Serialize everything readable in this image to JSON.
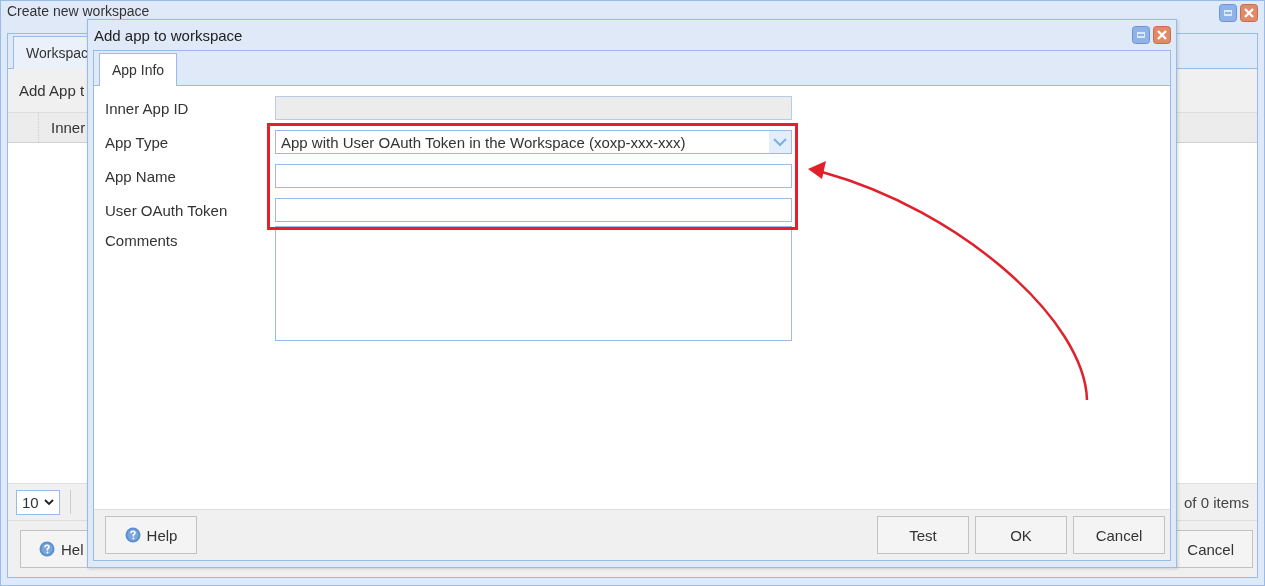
{
  "background_window": {
    "title": "Create new workspace",
    "tabs": [
      {
        "label": "Workspac",
        "selected": true
      }
    ],
    "toolbar_text": "Add App t",
    "grid": {
      "columns": [
        "Inner"
      ]
    },
    "paging": {
      "page_size": "10",
      "summary": "of 0 items"
    },
    "buttons": [
      {
        "label": "Hel",
        "kind": "help"
      },
      {
        "label": "Cancel",
        "kind": "plain"
      }
    ]
  },
  "dialog": {
    "title": "Add app to workspace",
    "tabs": [
      {
        "label": "App Info",
        "selected": true
      }
    ],
    "fields": [
      {
        "label": "Inner App ID",
        "kind": "text",
        "disabled": true
      },
      {
        "label": "App Type",
        "kind": "select",
        "value": "App with User OAuth Token in the Workspace (xoxp-xxx-xxx)"
      },
      {
        "label": "App Name",
        "kind": "text",
        "disabled": false
      },
      {
        "label": "User OAuth Token",
        "kind": "text",
        "disabled": false
      },
      {
        "label": "Comments",
        "kind": "textarea"
      }
    ],
    "buttons": [
      {
        "label": "Help",
        "kind": "help"
      },
      {
        "label": "Test",
        "kind": "plain"
      },
      {
        "label": "OK",
        "kind": "plain"
      },
      {
        "label": "Cancel",
        "kind": "plain"
      }
    ]
  }
}
